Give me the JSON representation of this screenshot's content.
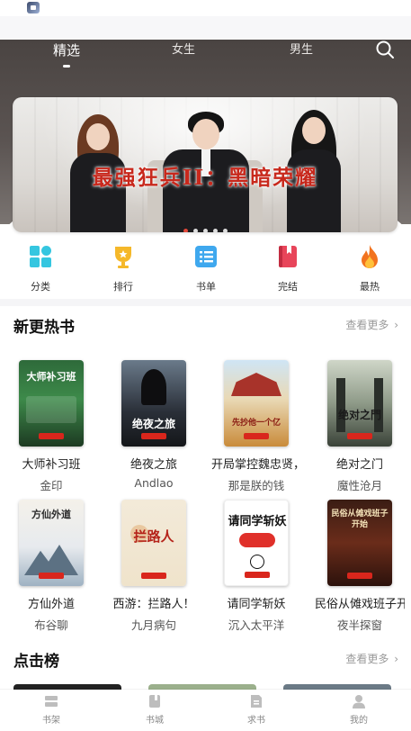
{
  "nav": {
    "tabs": [
      {
        "label": "精选",
        "active": true
      },
      {
        "label": "女生",
        "active": false
      },
      {
        "label": "男生",
        "active": false
      }
    ]
  },
  "banner": {
    "title": "最强狂兵II：黑暗荣耀",
    "dots": 5,
    "active_dot": 0,
    "accent": "#e2493b"
  },
  "categories": [
    {
      "label": "分类",
      "icon": "grid-icon",
      "color": "#35c6e0"
    },
    {
      "label": "排行",
      "icon": "trophy-icon",
      "color": "#f5b82a"
    },
    {
      "label": "书单",
      "icon": "list-icon",
      "color": "#3fa8ee"
    },
    {
      "label": "完结",
      "icon": "book-icon",
      "color": "#e8455a"
    },
    {
      "label": "最热",
      "icon": "flame-icon",
      "color": "#f2731e"
    }
  ],
  "new_hot": {
    "title": "新更热书",
    "more": "查看更多",
    "books": [
      {
        "title": "大师补习班",
        "author": "金印",
        "cover_text": "大师补习班"
      },
      {
        "title": "绝夜之旅",
        "author": "Andlao",
        "cover_text": "绝夜之旅"
      },
      {
        "title": "开局掌控魏忠贤，",
        "author": "那是朕的钱",
        "cover_text": "先抄他一个亿"
      },
      {
        "title": "绝对之门",
        "author": "魔性沧月",
        "cover_text": "绝对之門"
      },
      {
        "title": "方仙外道",
        "author": "布谷聊",
        "cover_text": "方仙外道"
      },
      {
        "title": "西游：拦路人！",
        "author": "九月病句",
        "cover_text": "拦路人"
      },
      {
        "title": "请同学斩妖",
        "author": "沉入太平洋",
        "cover_text": "请同学斩妖"
      },
      {
        "title": "民俗从傩戏班子开始",
        "author": "夜半探窗",
        "cover_text": "民俗从傩戏班子开始"
      }
    ]
  },
  "click_rank": {
    "title": "点击榜",
    "more": "查看更多"
  },
  "tab_bar": {
    "items": [
      {
        "label": "书架",
        "icon": "bookshelf-icon"
      },
      {
        "label": "书城",
        "icon": "bookstore-icon"
      },
      {
        "label": "求书",
        "icon": "request-book-icon"
      },
      {
        "label": "我的",
        "icon": "profile-icon"
      }
    ]
  }
}
